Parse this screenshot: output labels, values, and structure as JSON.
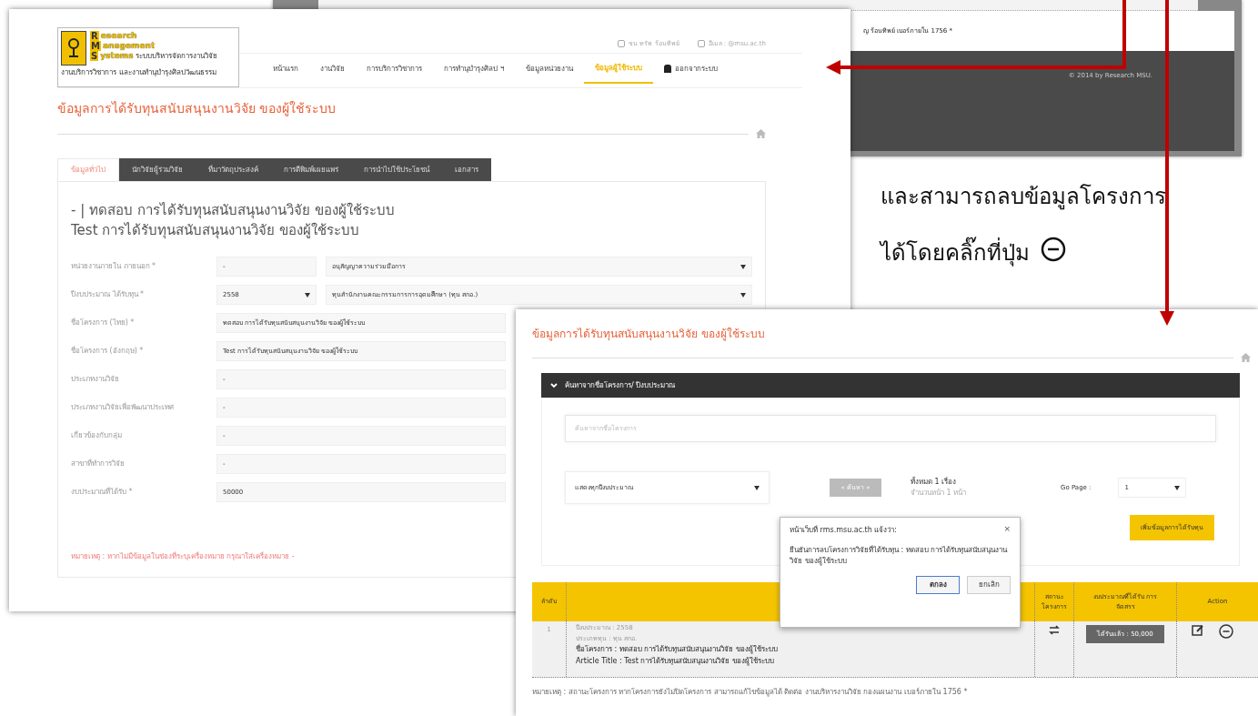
{
  "back_window": {
    "contact_text": "ญ ร้อนทิพย์ เบอร์ภายใน 1756 *",
    "copyright": "© 2014 by Research MSU."
  },
  "instruction": {
    "line1": "และสามารถลบข้อมูลโครงการ",
    "line2": "ได้โดยคลิ๊กที่ปุ่ม"
  },
  "edit_window": {
    "logo": {
      "letters": [
        "R",
        "M",
        "S"
      ],
      "words": [
        "esearch",
        "anagement",
        "ystems"
      ],
      "tagline": "ระบบบริหารจัดการงานวิจัย",
      "subtitle": "งานบริการวิชาการ และงานทำนุบำรุงศิลปวัฒนธรรม"
    },
    "top_info": [
      "ชน ทรัพ ร้อนทิพย์",
      "อีเมล : @msu.ac.th"
    ],
    "nav": [
      {
        "label": "หน้าแรก",
        "selected": false,
        "kind": "link"
      },
      {
        "label": "งานวิจัย",
        "selected": false,
        "kind": "link"
      },
      {
        "label": "การบริการวิชาการ",
        "selected": false,
        "kind": "link"
      },
      {
        "label": "การทำนุบำรุงศิลป ฯ",
        "selected": false,
        "kind": "link"
      },
      {
        "label": "ข้อมูลหน่วยงาน",
        "selected": false,
        "kind": "link"
      },
      {
        "label": "ข้อมูลผู้ใช้ระบบ",
        "selected": true,
        "kind": "link"
      },
      {
        "label": "ออกจากระบบ",
        "selected": false,
        "kind": "logout"
      }
    ],
    "page_title": "ข้อมูลการได้รับทุนสนับสนุนงานวิจัย ของผู้ใช้ระบบ",
    "tabs": [
      {
        "label": "ข้อมูลทั่วไป",
        "selected": true
      },
      {
        "label": "นักวิจัยผู้ร่วมวิจัย",
        "selected": false
      },
      {
        "label": "ที่มาวัตถุประสงค์",
        "selected": false
      },
      {
        "label": "การตีพิมพ์เผยแพร่",
        "selected": false
      },
      {
        "label": "การนำไปใช้ประโยชน์",
        "selected": false
      },
      {
        "label": "เอกสาร",
        "selected": false
      }
    ],
    "heading_lines": [
      "- | ทดสอบ การได้รับทุนสนับสนุนงานวิจัย ของผู้ใช้ระบบ",
      "Test การได้รับทุนสนับสนุนงานวิจัย ของผู้ใช้ระบบ"
    ],
    "fields": [
      {
        "label": "หน่วยงานภายใน ภายนอก *",
        "parts": [
          {
            "value": "-",
            "dropdown": false
          },
          {
            "value": "อนุสัญญาความร่วมมือการ",
            "dropdown": true
          }
        ]
      },
      {
        "label": "ปีงบประมาณ ได้รับทุน *",
        "parts": [
          {
            "value": "2558",
            "dropdown": true
          },
          {
            "value": "ทุนสำนักงานคณะกรรมการการอุดมศึกษา (ทุน สกอ.)",
            "dropdown": true
          }
        ]
      },
      {
        "label": "ชื่อโครงการ (ไทย) *",
        "parts": [
          {
            "value": "ทดสอบ การได้รับทุนสนับสนุนงานวิจัย ของผู้ใช้ระบบ",
            "dropdown": false
          }
        ]
      },
      {
        "label": "ชื่อโครงการ (อังกฤษ) *",
        "parts": [
          {
            "value": "Test การได้รับทุนสนับสนุนงานวิจัย ของผู้ใช้ระบบ",
            "dropdown": false
          }
        ]
      },
      {
        "label": "ประเภทงานวิจัย",
        "parts": [
          {
            "value": "-",
            "dropdown": false
          }
        ]
      },
      {
        "label": "ประเภทงานวิจัยเพื่อพัฒนาประเทศ",
        "parts": [
          {
            "value": "-",
            "dropdown": false
          }
        ]
      },
      {
        "label": "เกี่ยวข้องกับกลุ่ม",
        "parts": [
          {
            "value": "-",
            "dropdown": false
          }
        ]
      },
      {
        "label": "สาขาที่ทำการวิจัย",
        "parts": [
          {
            "value": "-",
            "dropdown": false
          }
        ]
      },
      {
        "label": "งบประมาณที่ได้รับ *",
        "parts": [
          {
            "value": "50000",
            "dropdown": false
          }
        ]
      }
    ],
    "note": "หมายเหตุ : หากไม่มีข้อมูลในช่องที่ระบุเครื่องหมาย กรุณาใส่เครื่องหมาย -"
  },
  "list_window": {
    "page_title": "ข้อมูลการได้รับทุนสนับสนุนงานวิจัย ของผู้ใช้ระบบ",
    "search_bar_title": "ค้นหาจากชื่อโครงการ/ ปีงบประมาณ",
    "search_placeholder": "ค้นหาจากชื่อโครงการ",
    "year_select": "แสดงทุกปีงบประมาณ",
    "search_button": "« ค้นหา »",
    "count": "ทั้งหมด 1 เรื่อง",
    "pages": "จำนวนหน้า 1 หน้า",
    "go_page_label": "Go Page :",
    "go_page_value": "1",
    "add_button": "เพิ่มข้อมูลการได้รับทุน",
    "columns": [
      "ลำดับ",
      "สถานะ โครงการ",
      "งบประมาณที่ได้รับ การจัดสรร",
      "Action"
    ],
    "rows": [
      {
        "index": "1",
        "details": [
          {
            "text": "ปีงบประมาณ : 2558",
            "strong": false
          },
          {
            "text": "ประเภททุน : ทุน สกอ.",
            "strong": false
          },
          {
            "text": "ชื่อโครงการ : ทดสอบ การได้รับทุนสนับสนุนงานวิจัย ของผู้ใช้ระบบ",
            "strong": true
          },
          {
            "text": "Article Title : Test การได้รับทุนสนับสนุนงานวิจัย ของผู้ใช้ระบบ",
            "strong": true
          }
        ],
        "budget": "ได้รับแล้ว : 50,000"
      }
    ],
    "footer_note": "หมายเหตุ : สถานะโครงการ หากโครงการยังไม่ปิดโครงการ สามารถแก้ไขข้อมูลได้ ติดต่อ งานบริหารงานวิจัย กองแผนงาน เบอร์ภายใน 1756 *"
  },
  "dialog": {
    "title": "หน้าเว็บที่ rms.msu.ac.th แจ้งว่า:",
    "close": "×",
    "message": "ยืนยันการลบโครงการวิจัยที่ได้รับทุน : ทดสอบ การได้รับทุนสนับสนุนงานวิจัย ของผู้ใช้ระบบ",
    "buttons": [
      "ตกลง",
      "ยกเลิก"
    ]
  }
}
